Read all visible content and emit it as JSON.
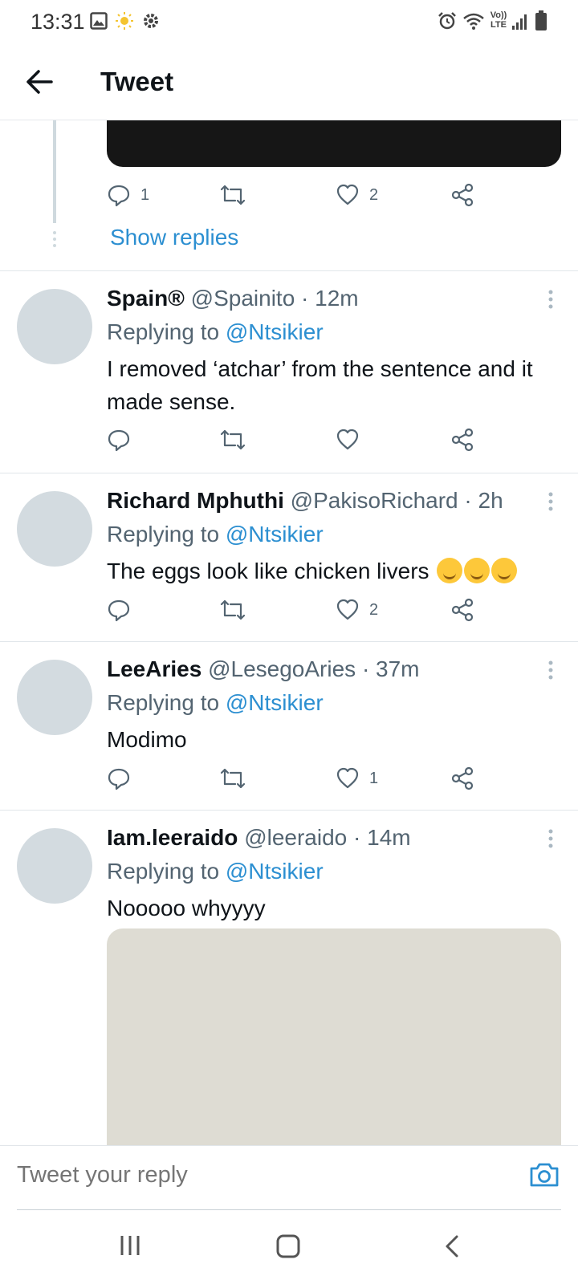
{
  "status_bar": {
    "time": "13:31",
    "left_icons": [
      "gallery-icon",
      "brightness-icon",
      "settings-icon"
    ],
    "right_icons": [
      "alarm-icon",
      "wifi-icon",
      "volte-icon",
      "signal-icon",
      "battery-icon"
    ],
    "volte_label_top": "Vo))",
    "volte_label_bottom": "LTE"
  },
  "header": {
    "title": "Tweet",
    "back_icon": "arrow-left-icon"
  },
  "thread": {
    "actions": {
      "reply": "1",
      "retweet": "",
      "like": "2"
    },
    "show_replies": "Show replies"
  },
  "tweets": [
    {
      "name": "Spain®",
      "handle": "@Spainito",
      "time": "· 12m",
      "replying_label": "Replying to",
      "replying_to": "@Ntsikier",
      "text": "I removed ‘atchar’ from the sentence and it made sense.",
      "actions": {
        "reply": "",
        "retweet": "",
        "like": ""
      }
    },
    {
      "name": "Richard Mphuthi",
      "handle": "@PakisoRichard",
      "time": "· 2h",
      "replying_label": "Replying to",
      "replying_to": "@Ntsikier",
      "text": "The eggs look like chicken livers",
      "emojis": [
        "relieved-face-emoji",
        "rolling-laughing-emoji",
        "rolling-laughing-emoji"
      ],
      "actions": {
        "reply": "",
        "retweet": "",
        "like": "2"
      }
    },
    {
      "name": "LeeAries",
      "handle": "@LesegoAries",
      "time": "· 37m",
      "replying_label": "Replying to",
      "replying_to": "@Ntsikier",
      "text": "Modimo",
      "actions": {
        "reply": "",
        "retweet": "",
        "like": "1"
      }
    },
    {
      "name": "Iam.leeraido",
      "handle": "@leeraido",
      "time": "· 14m",
      "replying_label": "Replying to",
      "replying_to": "@Ntsikier",
      "text": "Nooooo whyyyy"
    }
  ],
  "composer": {
    "placeholder": "Tweet your reply",
    "camera_icon": "camera-icon"
  },
  "nav_bar": {
    "buttons": [
      "recents-icon",
      "home-icon",
      "back-icon"
    ]
  },
  "colors": {
    "accent": "#2c8fd1",
    "text": "#0f1419",
    "muted": "#536471",
    "avatar_placeholder": "#d3dbe0"
  }
}
